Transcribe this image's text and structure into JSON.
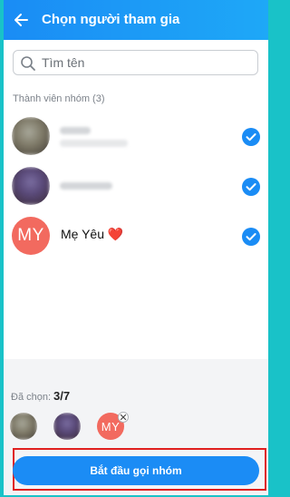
{
  "header": {
    "title": "Chọn người tham gia"
  },
  "search": {
    "placeholder": "Tìm tên"
  },
  "section": {
    "label": "Thành viên nhóm (3)"
  },
  "members": [
    {
      "initials": "",
      "name": "",
      "checked": true
    },
    {
      "initials": "",
      "name": "",
      "checked": true
    },
    {
      "initials": "MY",
      "name": "Mẹ Yêu",
      "emoji": "❤️",
      "checked": true
    }
  ],
  "selection": {
    "label": "Đã chọn:",
    "count": "3/7",
    "chip_initials": "MY"
  },
  "cta": {
    "label": "Bắt đầu gọi nhóm"
  },
  "colors": {
    "accent": "#1a8cf5",
    "avatar_my": "#f26a5f",
    "highlight_outline": "#e0201f",
    "frame": "#19c2c8"
  }
}
